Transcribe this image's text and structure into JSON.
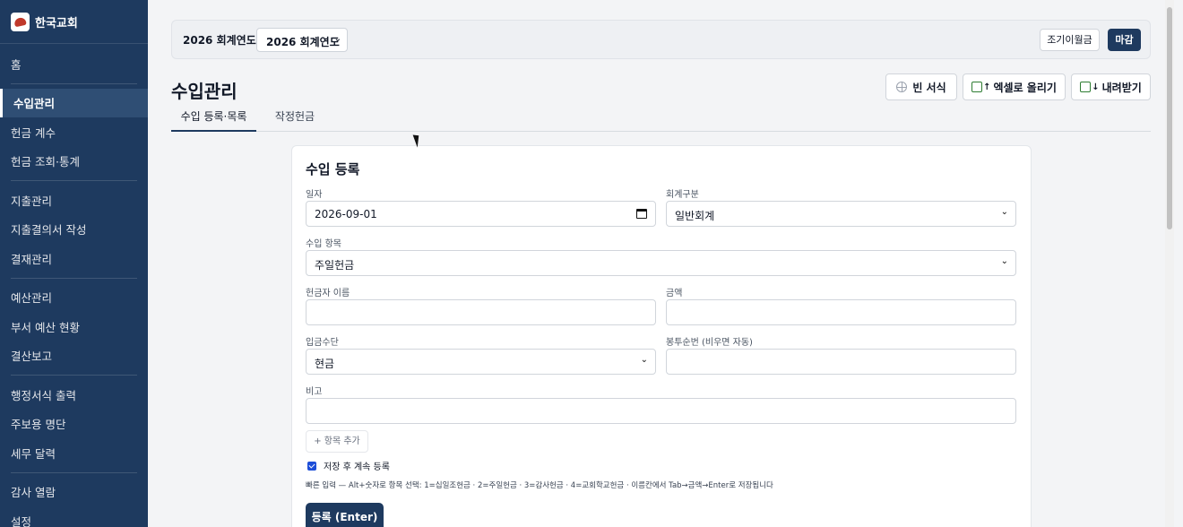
{
  "sidebar": {
    "brand": "한국교회",
    "items": [
      {
        "label": "홈"
      },
      {
        "label": "수입관리"
      },
      {
        "label": "헌금 계수"
      },
      {
        "label": "헌금 조회·통계"
      },
      {
        "label": "지출관리"
      },
      {
        "label": "지출결의서 작성"
      },
      {
        "label": "결재관리"
      },
      {
        "label": "예산관리"
      },
      {
        "label": "부서 예산 현황"
      },
      {
        "label": "결산보고"
      },
      {
        "label": "행정서식 출력"
      },
      {
        "label": "주보용 명단"
      },
      {
        "label": "세무 달력"
      },
      {
        "label": "감사 열람"
      },
      {
        "label": "설정"
      }
    ],
    "active_item": "수입관리"
  },
  "yearbar": {
    "label": "2026 회계연도",
    "select_value": "2026 회계연도",
    "early_button": "조기이월금",
    "close_button": "마감"
  },
  "page": {
    "title": "수입관리",
    "tools": {
      "blank_form": "빈 서식",
      "excel_upload": "엑셀로 올리기",
      "download": "내려받기"
    },
    "tabs": [
      {
        "label": "수입 등록·목록",
        "active": true
      },
      {
        "label": "작정헌금",
        "active": false
      }
    ]
  },
  "form": {
    "title": "수입 등록",
    "date": {
      "label": "일자",
      "value": "2026-09-01"
    },
    "account": {
      "label": "회계구분",
      "value": "일반회계"
    },
    "item": {
      "label": "수입 항목",
      "value": "주일헌금"
    },
    "donor": {
      "label": "헌금자 이름",
      "value": ""
    },
    "amount": {
      "label": "금액",
      "value": ""
    },
    "method": {
      "label": "입금수단",
      "value": "현금"
    },
    "envelope": {
      "label": "봉투순번 (비우면 자동)",
      "value": ""
    },
    "note": {
      "label": "비고",
      "value": ""
    },
    "add_item": "+ 항목 추가",
    "continue_label": "저장 후 계속 등록",
    "continue_checked": true,
    "hint": "빠른 입력 — Alt+숫자로 항목 선택: 1=십일조헌금 · 2=주일헌금 · 3=감사헌금 · 4=교회학교헌금 · 이름칸에서 Tab→금액→Enter로 저장됩니다",
    "submit": "등록 (Enter)"
  },
  "colors": {
    "sidebar_bg": "#1e3a5f",
    "primary": "#1e3a5f",
    "page_bg": "#f3f4f6"
  }
}
